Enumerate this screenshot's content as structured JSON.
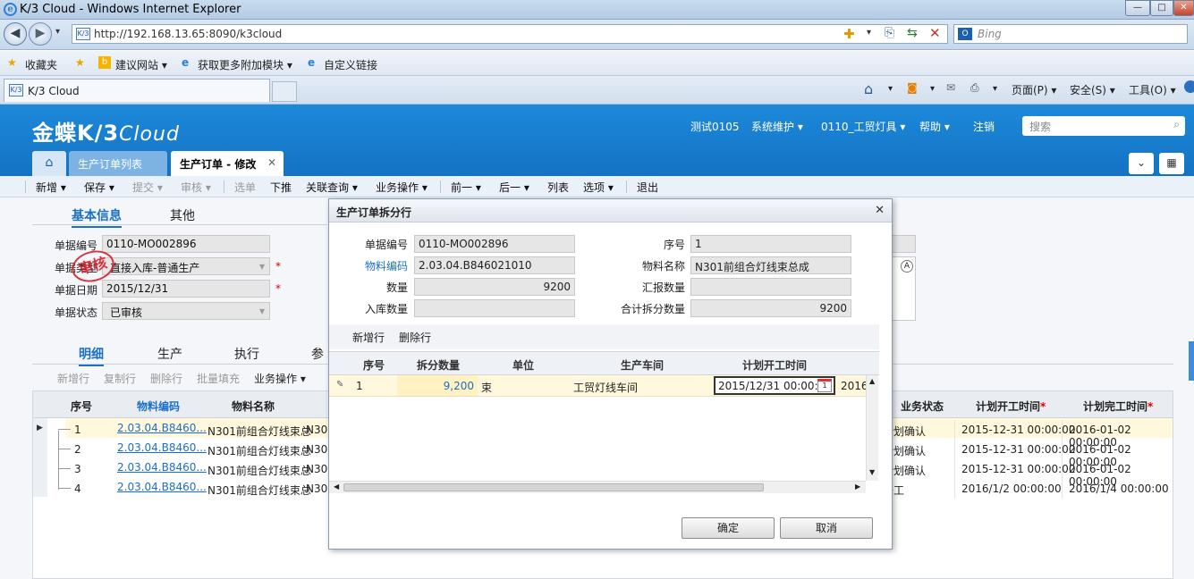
{
  "window": {
    "title": "K/3 Cloud - Windows Internet Explorer",
    "min": "—",
    "max": "□",
    "close": "✕"
  },
  "addressbar": {
    "url": "http://192.168.13.65:8090/k3cloud",
    "search_placeholder": "Bing"
  },
  "favorites": {
    "items": [
      "收藏夹",
      "建议网站 ▾",
      "获取更多附加模块 ▾",
      "自定义链接"
    ]
  },
  "browser_tab": {
    "label": "K/3 Cloud"
  },
  "browser_tools": {
    "page": "页面(P) ▾",
    "safety": "安全(S) ▾",
    "tools": "工具(O) ▾"
  },
  "app": {
    "logo_main": "金蝶K/3",
    "logo_cloud": "Cloud",
    "menu": [
      "测试0105",
      "系统维护 ▾",
      "0110_工贸灯具 ▾",
      "帮助 ▾",
      "注销"
    ],
    "search_placeholder": "搜索",
    "tabs": {
      "list": "生产订单列表",
      "active": "生产订单 - 修改",
      "close": "✕"
    }
  },
  "toolbar": {
    "items": [
      "新增 ▾",
      "保存 ▾",
      "提交 ▾",
      "审核 ▾",
      "选单",
      "下推",
      "关联查询 ▾",
      "业务操作 ▾",
      "前一 ▾",
      "后一 ▾",
      "列表",
      "选项 ▾",
      "退出"
    ]
  },
  "form": {
    "tabs": [
      "基本信息",
      "其他"
    ],
    "bill_no_label": "单据编号",
    "bill_no": "0110-MO002896",
    "bill_type_label": "单据类型",
    "bill_type": "直接入库-普通生产",
    "bill_date_label": "单据日期",
    "bill_date": "2015/12/31",
    "status_label": "单据状态",
    "status": "已审核",
    "stamp": "审核",
    "required": "*"
  },
  "detail": {
    "tabs": [
      "明细",
      "生产",
      "执行",
      "参"
    ],
    "actions": [
      "新增行",
      "复制行",
      "删除行",
      "批量填充",
      "业务操作 ▾"
    ],
    "headers": {
      "seq": "序号",
      "code": "物料编码",
      "name": "物料名称",
      "biz_status": "业务状态",
      "plan_start": "计划开工时间",
      "plan_end": "计划完工时间",
      "req": "*"
    },
    "rows": [
      {
        "seq": "1",
        "code": "2.03.04.B8460...",
        "name": "N301前组合灯线束总",
        "name2": "N30",
        "status": "计划确认",
        "start": "2015-12-31 00:00:00",
        "end": "2016-01-02 00:00:00"
      },
      {
        "seq": "2",
        "code": "2.03.04.B8460...",
        "name": "N301前组合灯线束总",
        "name2": "N30",
        "status": "计划确认",
        "start": "2015-12-31 00:00:00",
        "end": "2016-01-02 00:00:00"
      },
      {
        "seq": "3",
        "code": "2.03.04.B8460...",
        "name": "N301前组合灯线束总",
        "name2": "N30",
        "status": "计划确认",
        "start": "2015-12-31 00:00:00",
        "end": "2016-01-02 00:00:00"
      },
      {
        "seq": "4",
        "code": "2.03.04.B8460...",
        "name": "N301前组合灯线束总",
        "name2": "N30",
        "status": "开工",
        "start": "2016/1/2 00:00:00",
        "end": "2016/1/4 00:00:00"
      }
    ]
  },
  "dialog": {
    "title": "生产订单拆分行",
    "close": "✕",
    "bill_no_label": "单据编号",
    "bill_no": "0110-MO002896",
    "seq_label": "序号",
    "seq": "1",
    "mat_code_label": "物料编码",
    "mat_code": "2.03.04.B846021010",
    "mat_name_label": "物料名称",
    "mat_name": "N301前组合灯线束总成",
    "qty_label": "数量",
    "qty": "9200",
    "report_qty_label": "汇报数量",
    "report_qty": "",
    "in_qty_label": "入库数量",
    "in_qty": "",
    "split_total_label": "合计拆分数量",
    "split_total": "9200",
    "grid_actions": [
      "新增行",
      "删除行"
    ],
    "grid_headers": [
      "序号",
      "拆分数量",
      "单位",
      "生产车间",
      "计划开工时间"
    ],
    "row": {
      "seq": "1",
      "qty": "9,200",
      "unit": "束",
      "workshop": "工贸灯线车间",
      "start": "2015/12/31 00:00:00",
      "next": "2016"
    },
    "ok": "确定",
    "cancel": "取消"
  }
}
